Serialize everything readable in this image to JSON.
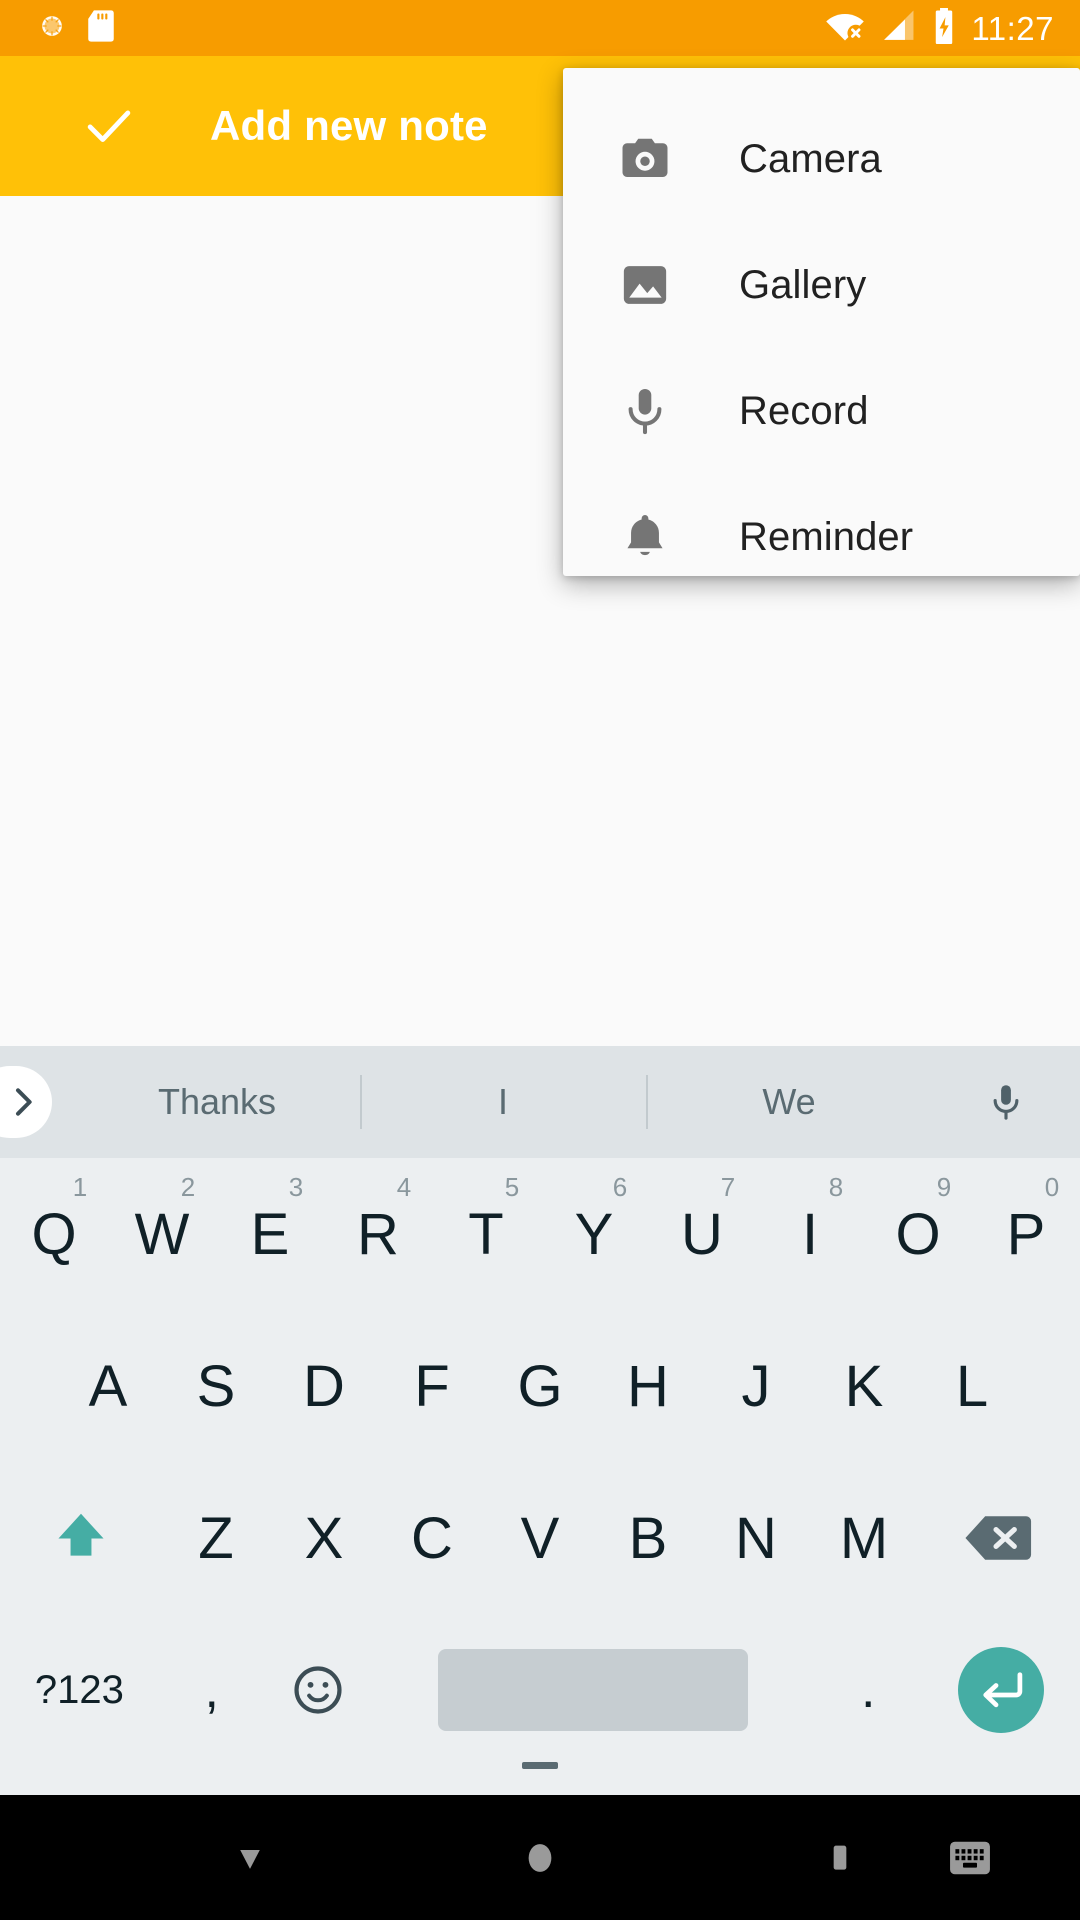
{
  "status_bar": {
    "time": "11:27",
    "background_color": "#F79C00",
    "icons_left": [
      "brightness-sun-icon",
      "sd-card-icon"
    ],
    "icons_right": [
      "wifi-no-internet-icon",
      "cellular-signal-icon",
      "battery-charging-icon"
    ]
  },
  "app_bar": {
    "title": "Add new note",
    "confirm_icon": "check-icon",
    "background_color": "#FFC107",
    "text_color": "#FFFFFF"
  },
  "note": {
    "value": "",
    "placeholder": ""
  },
  "popup_menu": {
    "background_color": "#FAFAFA",
    "items": [
      {
        "label": "Camera",
        "icon": "camera-icon"
      },
      {
        "label": "Gallery",
        "icon": "image-icon"
      },
      {
        "label": "Record",
        "icon": "microphone-icon"
      },
      {
        "label": "Reminder",
        "icon": "bell-icon"
      }
    ]
  },
  "keyboard": {
    "background_color": "#ECEFF1",
    "accent_color": "#45ADA4",
    "suggestion_bar": {
      "expand_icon": "chevron-right-icon",
      "suggestions": [
        "Thanks",
        "I",
        "We"
      ],
      "mic_icon": "microphone-icon"
    },
    "row1": [
      {
        "key": "Q",
        "num": "1"
      },
      {
        "key": "W",
        "num": "2"
      },
      {
        "key": "E",
        "num": "3"
      },
      {
        "key": "R",
        "num": "4"
      },
      {
        "key": "T",
        "num": "5"
      },
      {
        "key": "Y",
        "num": "6"
      },
      {
        "key": "U",
        "num": "7"
      },
      {
        "key": "I",
        "num": "8"
      },
      {
        "key": "O",
        "num": "9"
      },
      {
        "key": "P",
        "num": "0"
      }
    ],
    "row2": [
      "A",
      "S",
      "D",
      "F",
      "G",
      "H",
      "J",
      "K",
      "L"
    ],
    "row3": {
      "shift_icon": "shift-caps-lock-icon",
      "letters": [
        "Z",
        "X",
        "C",
        "V",
        "B",
        "N",
        "M"
      ],
      "backspace_icon": "backspace-icon"
    },
    "row4": {
      "symbols_label": "?123",
      "comma": ",",
      "emoji_icon": "emoji-smiley-icon",
      "space": "",
      "period": ".",
      "enter_icon": "enter-return-icon"
    }
  },
  "nav_bar": {
    "background_color": "#000000",
    "buttons": [
      {
        "name": "back",
        "icon": "back-down-triangle-icon"
      },
      {
        "name": "home",
        "icon": "home-circle-icon"
      },
      {
        "name": "recents",
        "icon": "recents-square-icon"
      },
      {
        "name": "keyboard",
        "icon": "keyboard-icon"
      }
    ]
  }
}
